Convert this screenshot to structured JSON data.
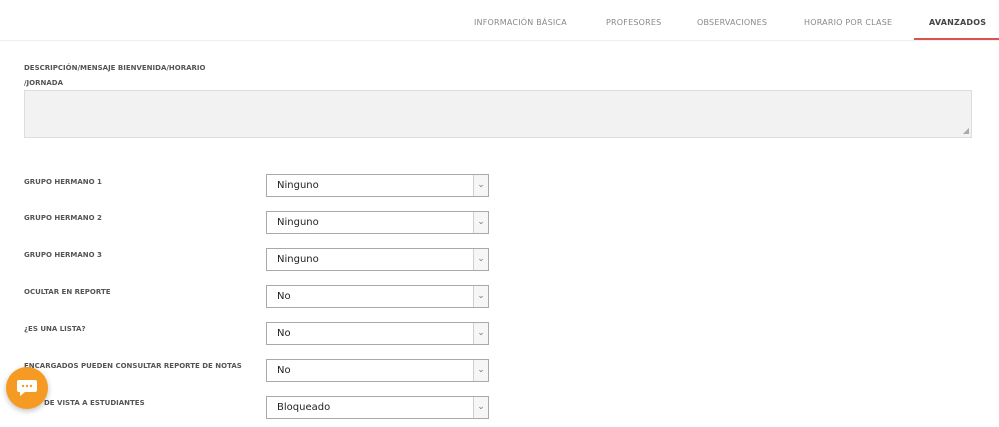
{
  "tabs": [
    {
      "label": "INFORMACIÓN BÁSICA"
    },
    {
      "label": "PROFESORES"
    },
    {
      "label": "OBSERVACIONES"
    },
    {
      "label": "HORARIO POR CLASE"
    },
    {
      "label": "AVANZADOS"
    }
  ],
  "active_tab": "AVANZADOS",
  "description": {
    "label_line1": "DESCRIPCIÓN/MENSAJE BIENVENIDA/HORARIO",
    "label_line2": "/JORNADA",
    "value": ""
  },
  "fields": [
    {
      "label": "GRUPO HERMANO 1",
      "value": "Ninguno"
    },
    {
      "label": "GRUPO HERMANO 2",
      "value": "Ninguno"
    },
    {
      "label": "GRUPO HERMANO 3",
      "value": "Ninguno"
    },
    {
      "label": "OCULTAR EN REPORTE",
      "value": "No"
    },
    {
      "label": "¿ES UNA LISTA?",
      "value": "No"
    },
    {
      "label": "ENCARGADOS PUEDEN CONSULTAR REPORTE DE NOTAS",
      "value": "No"
    },
    {
      "label": "DE VISTA A ESTUDIANTES",
      "value": "Bloqueado"
    }
  ],
  "colors": {
    "accent": "#d9534f",
    "chat": "#f59a23"
  },
  "chat_button": {
    "icon": "chat-bubble-icon"
  }
}
